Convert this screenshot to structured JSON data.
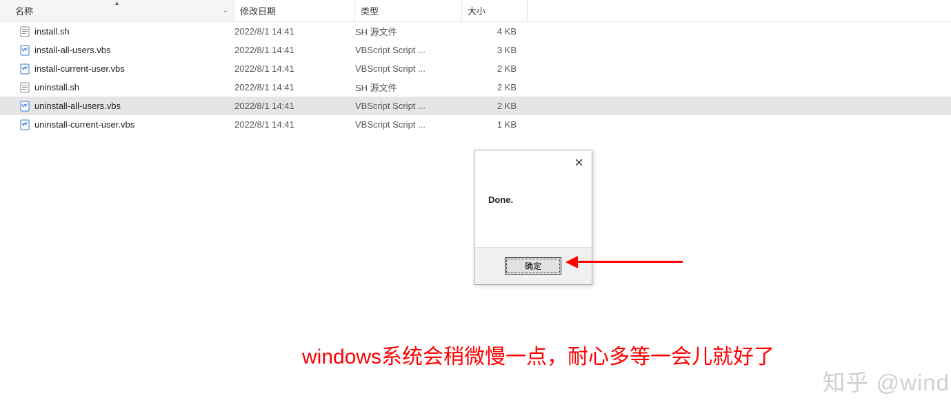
{
  "columns": {
    "name": "名称",
    "date": "修改日期",
    "type": "类型",
    "size": "大小"
  },
  "files": [
    {
      "name": "install.sh",
      "date": "2022/8/1 14:41",
      "type": "SH 源文件",
      "size": "4 KB",
      "icon": "sh",
      "selected": false
    },
    {
      "name": "install-all-users.vbs",
      "date": "2022/8/1 14:41",
      "type": "VBScript Script ...",
      "size": "3 KB",
      "icon": "vbs",
      "selected": false
    },
    {
      "name": "install-current-user.vbs",
      "date": "2022/8/1 14:41",
      "type": "VBScript Script ...",
      "size": "2 KB",
      "icon": "vbs",
      "selected": false
    },
    {
      "name": "uninstall.sh",
      "date": "2022/8/1 14:41",
      "type": "SH 源文件",
      "size": "2 KB",
      "icon": "sh",
      "selected": false
    },
    {
      "name": "uninstall-all-users.vbs",
      "date": "2022/8/1 14:41",
      "type": "VBScript Script ...",
      "size": "2 KB",
      "icon": "vbs",
      "selected": true
    },
    {
      "name": "uninstall-current-user.vbs",
      "date": "2022/8/1 14:41",
      "type": "VBScript Script ...",
      "size": "1 KB",
      "icon": "vbs",
      "selected": false
    }
  ],
  "dialog": {
    "message": "Done.",
    "ok": "确定"
  },
  "annotation": "windows系统会稍微慢一点，耐心多等一会儿就好了",
  "watermark": "知乎 @wind"
}
